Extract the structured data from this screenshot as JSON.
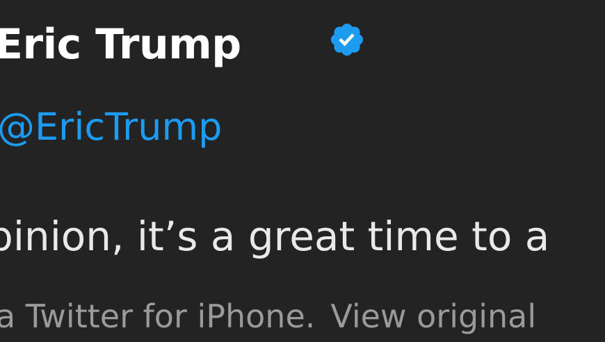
{
  "tweet": {
    "author": {
      "display_name": "Eric Trump",
      "handle": "@EricTrump",
      "verified_icon": "verified-badge-icon",
      "verified_color": "#1d9bf0"
    },
    "text": "pinion, it’s a great time to a",
    "source": "a Twitter for iPhone.",
    "view_original_label": "View original"
  },
  "colors": {
    "background": "#232323",
    "name": "#ffffff",
    "handle": "#1d9bf0",
    "text": "#e7e9ea",
    "meta": "#9a9a9a"
  }
}
